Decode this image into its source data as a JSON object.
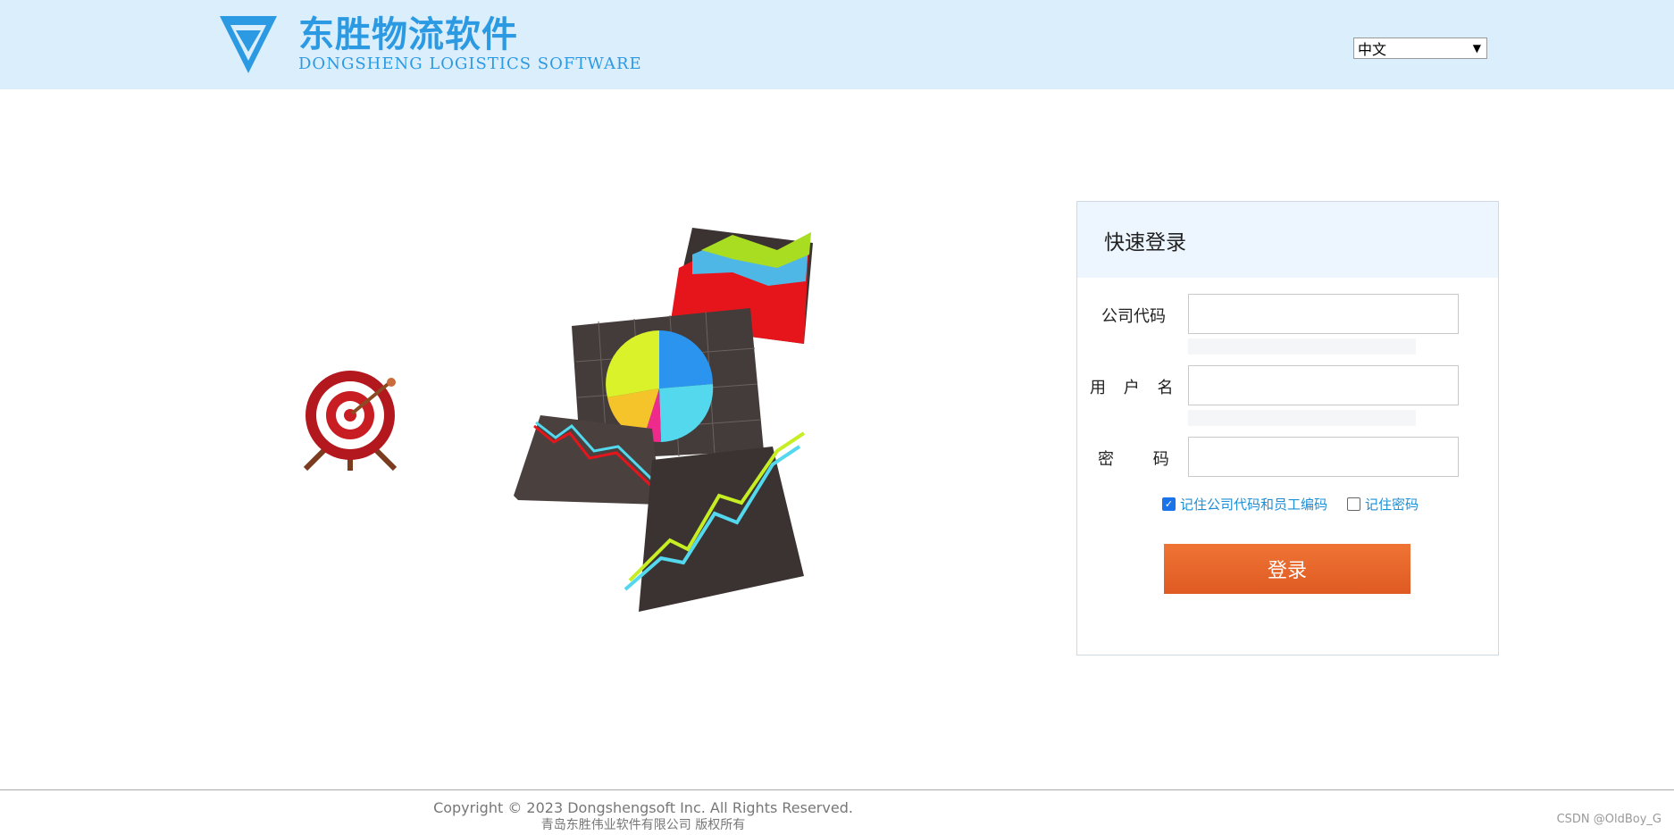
{
  "header": {
    "logo_cn": "东胜物流软件",
    "logo_en": "DONGSHENG LOGISTICS SOFTWARE",
    "language_selected": "中文",
    "brand_color": "#2c9ae3"
  },
  "login": {
    "title": "快速登录",
    "company_code_label": "公司代码",
    "username_label": "用 户 名",
    "password_label": "密 码",
    "remember_company": "记住公司代码和员工编码",
    "remember_company_checked": true,
    "remember_password": "记住密码",
    "remember_password_checked": false,
    "submit_label": "登录"
  },
  "footer": {
    "copyright": "Copyright © 2023 Dongshengsoft Inc. All Rights Reserved.",
    "company": "青岛东胜伟业软件有限公司 版权所有",
    "watermark": "CSDN @OldBoy_G"
  }
}
